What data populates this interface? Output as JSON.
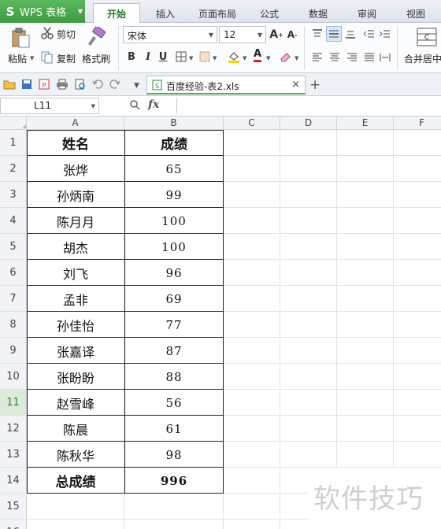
{
  "app": {
    "logo": "S",
    "name": "WPS 表格"
  },
  "tabs": [
    {
      "label": "开始",
      "active": true
    },
    {
      "label": "插入"
    },
    {
      "label": "页面布局"
    },
    {
      "label": "公式"
    },
    {
      "label": "数据"
    },
    {
      "label": "审阅"
    },
    {
      "label": "视图"
    }
  ],
  "ribbon": {
    "paste_label": "粘贴",
    "cut_label": "剪切",
    "copy_label": "复制",
    "format_painter_label": "格式刷",
    "font_name": "宋体",
    "font_size": "12",
    "bold": "B",
    "italic": "I",
    "underline": "U",
    "font_color_letter": "A",
    "grow_font": "A",
    "shrink_font": "A",
    "merge_label": "合并居中"
  },
  "document": {
    "tab_name": "百度经验-表2.xls",
    "close": "×",
    "add": "+"
  },
  "formula_bar": {
    "name_box": "L11",
    "fx": "fx",
    "formula": ""
  },
  "columns": [
    "A",
    "B",
    "C",
    "D",
    "E",
    "F"
  ],
  "rows": [
    "1",
    "2",
    "3",
    "4",
    "5",
    "6",
    "7",
    "8",
    "9",
    "10",
    "11",
    "12",
    "13",
    "14",
    "15",
    "16"
  ],
  "selected_row": "11",
  "table": {
    "header": [
      "姓名",
      "成绩"
    ],
    "rows": [
      [
        "张烨",
        "65"
      ],
      [
        "孙炳南",
        "99"
      ],
      [
        "陈月月",
        "100"
      ],
      [
        "胡杰",
        "100"
      ],
      [
        "刘飞",
        "96"
      ],
      [
        "孟非",
        "69"
      ],
      [
        "孙佳怡",
        "77"
      ],
      [
        "张嘉译",
        "87"
      ],
      [
        "张盼盼",
        "88"
      ],
      [
        "赵雪峰",
        "56"
      ],
      [
        "陈晨",
        "61"
      ],
      [
        "陈秋华",
        "98"
      ]
    ],
    "total": [
      "总成绩",
      "996"
    ]
  },
  "watermark": "软件技巧",
  "colors": {
    "brand_green": "#3f9b3f",
    "active_tab_text": "#1e7b2a",
    "grid_line": "#dfe2e6"
  }
}
